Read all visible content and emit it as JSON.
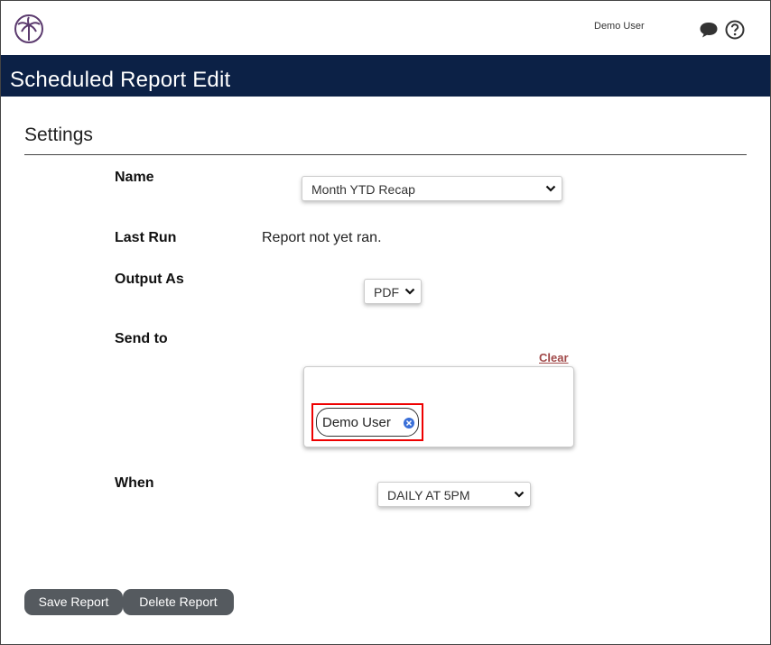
{
  "topbar": {
    "user_name": "Demo User"
  },
  "header": {
    "title": "Scheduled Report Edit"
  },
  "settings": {
    "section_title": "Settings",
    "name": {
      "label": "Name",
      "selected": "Month YTD Recap"
    },
    "last_run": {
      "label": "Last Run",
      "value": "Report not yet ran."
    },
    "output_as": {
      "label": "Output As",
      "selected": "PDF"
    },
    "send_to": {
      "label": "Send to",
      "clear_label": "Clear",
      "recipients": [
        {
          "name": "Demo User"
        }
      ]
    },
    "when": {
      "label": "When",
      "selected": "DAILY AT 5PM"
    }
  },
  "actions": {
    "save_label": "Save Report",
    "delete_label": "Delete Report"
  },
  "colors": {
    "header_bg": "#0c2146",
    "button_bg": "#555a5f",
    "clear_link": "#a04848",
    "highlight_border": "#ee0000",
    "chip_remove": "#3a6fd8",
    "logo": "#5b3a6e"
  },
  "icons": {
    "logo": "palm-tree-logo-icon",
    "chat": "speech-bubble-icon",
    "help": "question-circle-icon",
    "dropdown": "chevron-down-icon",
    "remove": "close-circle-icon"
  }
}
